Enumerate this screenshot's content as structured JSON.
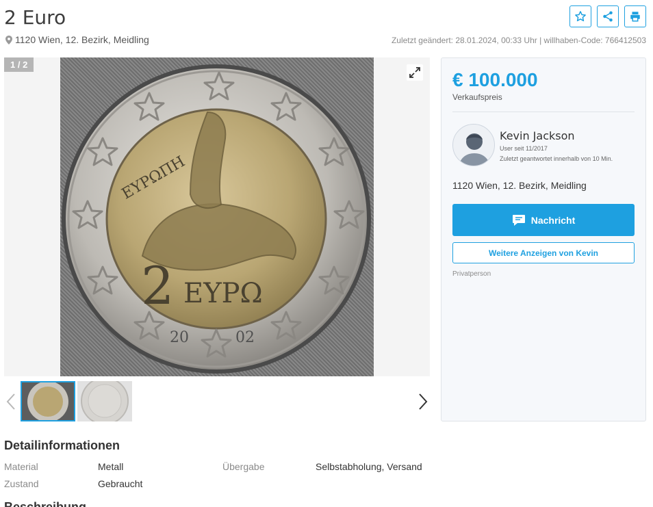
{
  "listing": {
    "title": "2 Euro",
    "location": "1120 Wien, 12. Bezirk, Meidling",
    "meta": "Zuletzt geändert: 28.01.2024, 00:33 Uhr | willhaben-Code: 766412503"
  },
  "gallery": {
    "counter": "1 / 2",
    "coin_top_text": "ΕΥΡΩΠΗ",
    "coin_value": "2",
    "coin_currency": "ΕΥΡΩ",
    "coin_year_left": "20",
    "coin_year_right": "02"
  },
  "sidebar": {
    "price": "€ 100.000",
    "price_label": "Verkaufspreis",
    "seller_name": "Kevin Jackson",
    "seller_since": "User seit 11/2017",
    "seller_response": "Zuletzt geantwortet innerhalb von 10 Min.",
    "seller_location": "1120 Wien, 12. Bezirk, Meidling",
    "message_button": "Nachricht",
    "more_ads_button": "Weitere Anzeigen von Kevin",
    "seller_type": "Privatperson"
  },
  "details": {
    "heading": "Detailinformationen",
    "rows": [
      {
        "key": "Material",
        "value": "Metall"
      },
      {
        "key": "Übergabe",
        "value": "Selbstabholung, Versand"
      },
      {
        "key": "Zustand",
        "value": "Gebraucht"
      }
    ]
  },
  "description": {
    "heading": "Beschreibung"
  },
  "colors": {
    "accent": "#1ea0e0"
  }
}
